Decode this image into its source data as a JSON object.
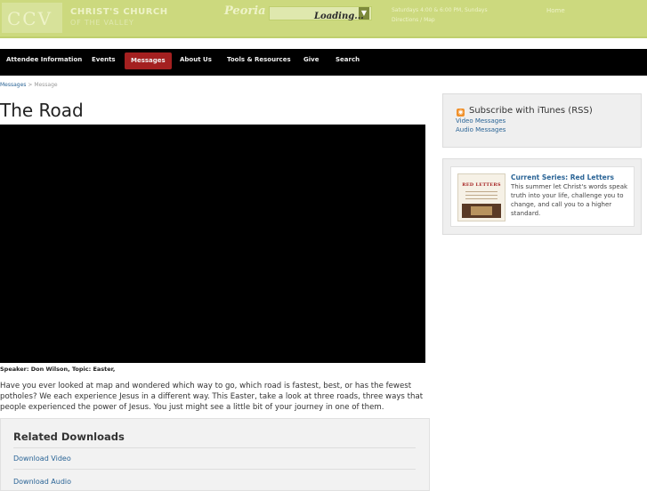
{
  "header": {
    "logo_mark": "CCV",
    "logo_line1": "CHRIST'S CHURCH",
    "logo_line2": "OF THE VALLEY",
    "campus_label": "Peoria",
    "loading_text": "Loading...",
    "info_line1": "Saturdays 4:00 & 6:00 PM, Sundays",
    "info_line2": "Directions / Map",
    "info_link": "Home"
  },
  "nav": {
    "items": [
      "Attendee Information",
      "Events",
      "Messages",
      "About Us",
      "Tools & Resources",
      "Give",
      "Search"
    ],
    "active": "Messages"
  },
  "breadcrumb": {
    "link": "Messages",
    "separator": ">",
    "current": "Message"
  },
  "message": {
    "title": "The Road",
    "speaker_line": "Speaker: Don Wilson, Topic: Easter,",
    "description": "Have you ever looked at map and wondered which way to go, which road is fastest, best, or has the fewest potholes? We each experience Jesus in a different way. This Easter, take a look at three roads, three ways that people experienced the power of Jesus. You just might see a little bit of your journey in one of them."
  },
  "downloads": {
    "title": "Related Downloads",
    "video": "Download Video",
    "audio": "Download Audio"
  },
  "subscribe": {
    "title": "Subscribe with iTunes (RSS)",
    "video": "Video Messages",
    "audio": "Audio Messages"
  },
  "series": {
    "heading": "Current Series: Red Letters",
    "image_title": "RED LETTERS",
    "description": "This summer let Christ's words speak truth into your life, challenge you to change, and call you to a higher standard."
  },
  "colors": {
    "header_bg": "#ccd97e",
    "nav_bg": "#000000",
    "nav_active": "#a42020",
    "link": "#2a6496"
  }
}
